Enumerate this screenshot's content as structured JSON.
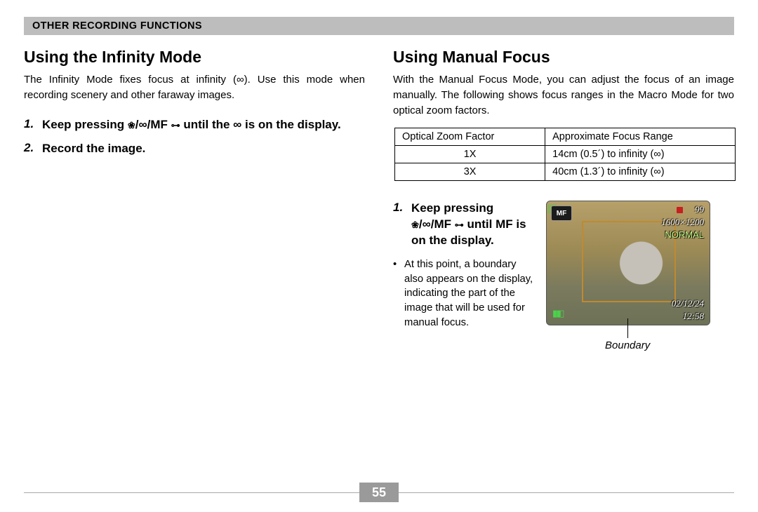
{
  "section_header": "OTHER RECORDING FUNCTIONS",
  "page_number": "55",
  "left": {
    "heading": "Using the Infinity Mode",
    "body": "The Infinity Mode fixes focus at infinity (∞). Use this mode when recording scenery and other faraway images.",
    "step1_num": "1.",
    "step1_a": "Keep pressing ",
    "step1_b": "/∞/MF ",
    "step1_c": " until the ∞ is on the display.",
    "step2_num": "2.",
    "step2": "Record the image."
  },
  "right": {
    "heading": "Using Manual Focus",
    "body": "With the Manual Focus Mode, you can adjust the focus of an image manually. The following shows focus ranges in the Macro Mode for two optical zoom factors.",
    "table": {
      "h1": "Optical Zoom Factor",
      "h2": "Approximate Focus Range",
      "r1c1": "1X",
      "r1c2": "14cm (0.5´) to infinity (∞)",
      "r2c1": "3X",
      "r2c2": "40cm (1.3´) to infinity (∞)"
    },
    "step1_num": "1.",
    "step1_a": "Keep pressing",
    "step1_b": "/∞/MF ",
    "step1_c": " until MF is on the display.",
    "bullet": "At this point, a boundary also appears on the display, indicating the part of the image that will be used for manual focus.",
    "boundary_label": "Boundary"
  },
  "preview": {
    "mf": "MF",
    "shots": "99",
    "res": "1600×1200",
    "normal": "NORMAL",
    "date": "02/12/24",
    "time": "12:58"
  }
}
